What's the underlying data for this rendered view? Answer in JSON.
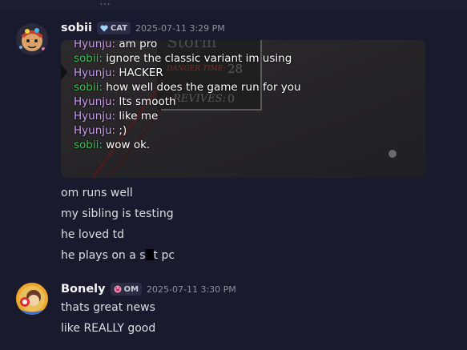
{
  "top_fragment": "… ",
  "messages": [
    {
      "username": "sobii",
      "tag": "CAT",
      "timestamp": "2025-07-11 3:29 PM",
      "embed": {
        "game_text": [
          "Storm",
          "DANGER TIME:",
          "28",
          "REVIVES:",
          "0"
        ],
        "lines": [
          {
            "speaker": "Hyunju:",
            "text": "am pro"
          },
          {
            "speaker": "sobii:",
            "text": "ignore the classic variant im using"
          },
          {
            "speaker": "Hyunju:",
            "text": "HACKER"
          },
          {
            "speaker": "sobii:",
            "text": "how well does the game run for you"
          },
          {
            "speaker": "Hyunju:",
            "text": "Its smooth"
          },
          {
            "speaker": "Hyunju:",
            "text": "like me"
          },
          {
            "speaker": "Hyunju:",
            "text": ";)"
          },
          {
            "speaker": "sobii:",
            "text": "wow ok."
          }
        ]
      },
      "lines": [
        "om runs well",
        "my sibling is testing",
        "he loved td",
        "he plays on a s",
        "t pc"
      ]
    },
    {
      "username": "Bonely",
      "tag": "OM",
      "timestamp": "2025-07-11 3:30 PM",
      "lines": [
        "thats great news",
        "like REALLY good"
      ]
    }
  ],
  "colors": {
    "background": "#1a1a2e",
    "hyunju_name": "#c79cf0",
    "sobii_name": "#2fc24b",
    "tag_bg": "#2c2c44"
  }
}
